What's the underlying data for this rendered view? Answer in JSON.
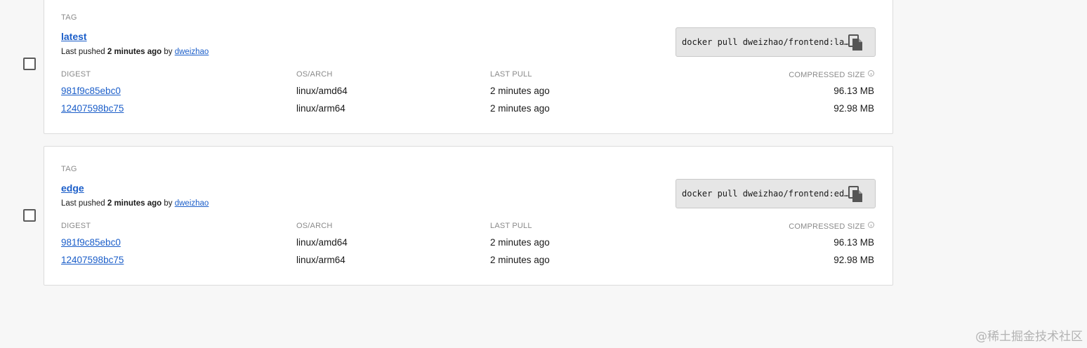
{
  "tags": [
    {
      "section_label": "TAG",
      "name": "latest",
      "pushed_prefix": "Last pushed ",
      "pushed_time": "2 minutes ago",
      "pushed_by_word": " by ",
      "pushed_by": "dweizhao",
      "pull_command": "docker pull dweizhao/frontend:latest",
      "headers": {
        "digest": "DIGEST",
        "os_arch": "OS/ARCH",
        "last_pull": "LAST PULL",
        "size": "COMPRESSED SIZE"
      },
      "rows": [
        {
          "digest": "981f9c85ebc0",
          "os_arch": "linux/amd64",
          "last_pull": "2 minutes ago",
          "size": "96.13 MB"
        },
        {
          "digest": "12407598bc75",
          "os_arch": "linux/arm64",
          "last_pull": "2 minutes ago",
          "size": "92.98 MB"
        }
      ]
    },
    {
      "section_label": "TAG",
      "name": "edge",
      "pushed_prefix": "Last pushed ",
      "pushed_time": "2 minutes ago",
      "pushed_by_word": " by ",
      "pushed_by": "dweizhao",
      "pull_command": "docker pull dweizhao/frontend:edge",
      "headers": {
        "digest": "DIGEST",
        "os_arch": "OS/ARCH",
        "last_pull": "LAST PULL",
        "size": "COMPRESSED SIZE"
      },
      "rows": [
        {
          "digest": "981f9c85ebc0",
          "os_arch": "linux/amd64",
          "last_pull": "2 minutes ago",
          "size": "96.13 MB"
        },
        {
          "digest": "12407598bc75",
          "os_arch": "linux/arm64",
          "last_pull": "2 minutes ago",
          "size": "92.98 MB"
        }
      ]
    }
  ],
  "watermark": "@稀土掘金技术社区",
  "icons": {
    "copy": "copy-icon",
    "info": "info-icon"
  }
}
